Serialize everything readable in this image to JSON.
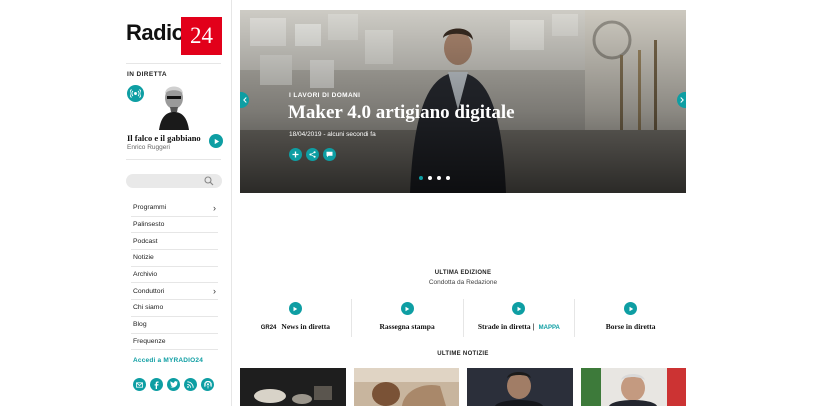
{
  "sidebar": {
    "logo": {
      "word": "Radio",
      "number": "24"
    },
    "live": {
      "label": "IN DIRETTA",
      "show_title": "Il falco e il gabbiano",
      "host": "Enrico Ruggeri"
    },
    "search": {
      "placeholder": ""
    },
    "nav": [
      {
        "label": "Programmi",
        "has_submenu": true
      },
      {
        "label": "Palinsesto",
        "has_submenu": false
      },
      {
        "label": "Podcast",
        "has_submenu": false
      },
      {
        "label": "Notizie",
        "has_submenu": false
      },
      {
        "label": "Archivio",
        "has_submenu": false
      },
      {
        "label": "Conduttori",
        "has_submenu": true
      },
      {
        "label": "Chi siamo",
        "has_submenu": false
      },
      {
        "label": "Blog",
        "has_submenu": false
      },
      {
        "label": "Frequenze",
        "has_submenu": false
      }
    ],
    "login": "Accedi a MYRADIO24",
    "socials": [
      "email-icon",
      "facebook-icon",
      "twitter-icon",
      "rss-icon",
      "podcast-icon"
    ]
  },
  "hero": {
    "kicker": "I LAVORI DI DOMANI",
    "title": "Maker 4.0 artigiano digitale",
    "meta": "18/04/2019 - alcuni secondi fa",
    "actions": [
      "plus-icon",
      "share-icon",
      "comment-icon"
    ],
    "slides": 4,
    "active_slide": 1
  },
  "edition": {
    "title": "ULTIMA EDIZIONE",
    "subtitle": "Condotta da Redazione",
    "programs": [
      {
        "prefix": "GR24",
        "label": "News in diretta",
        "suffix": ""
      },
      {
        "prefix": "",
        "label": "Rassegna stampa",
        "suffix": ""
      },
      {
        "prefix": "",
        "label": "Strade in diretta",
        "suffix": "MAPPA"
      },
      {
        "prefix": "",
        "label": "Borse in diretta",
        "suffix": ""
      }
    ]
  },
  "news": {
    "title": "ULTIME NOTIZIE"
  },
  "colors": {
    "accent": "#0e9ea3",
    "brand_red": "#e2001a"
  }
}
